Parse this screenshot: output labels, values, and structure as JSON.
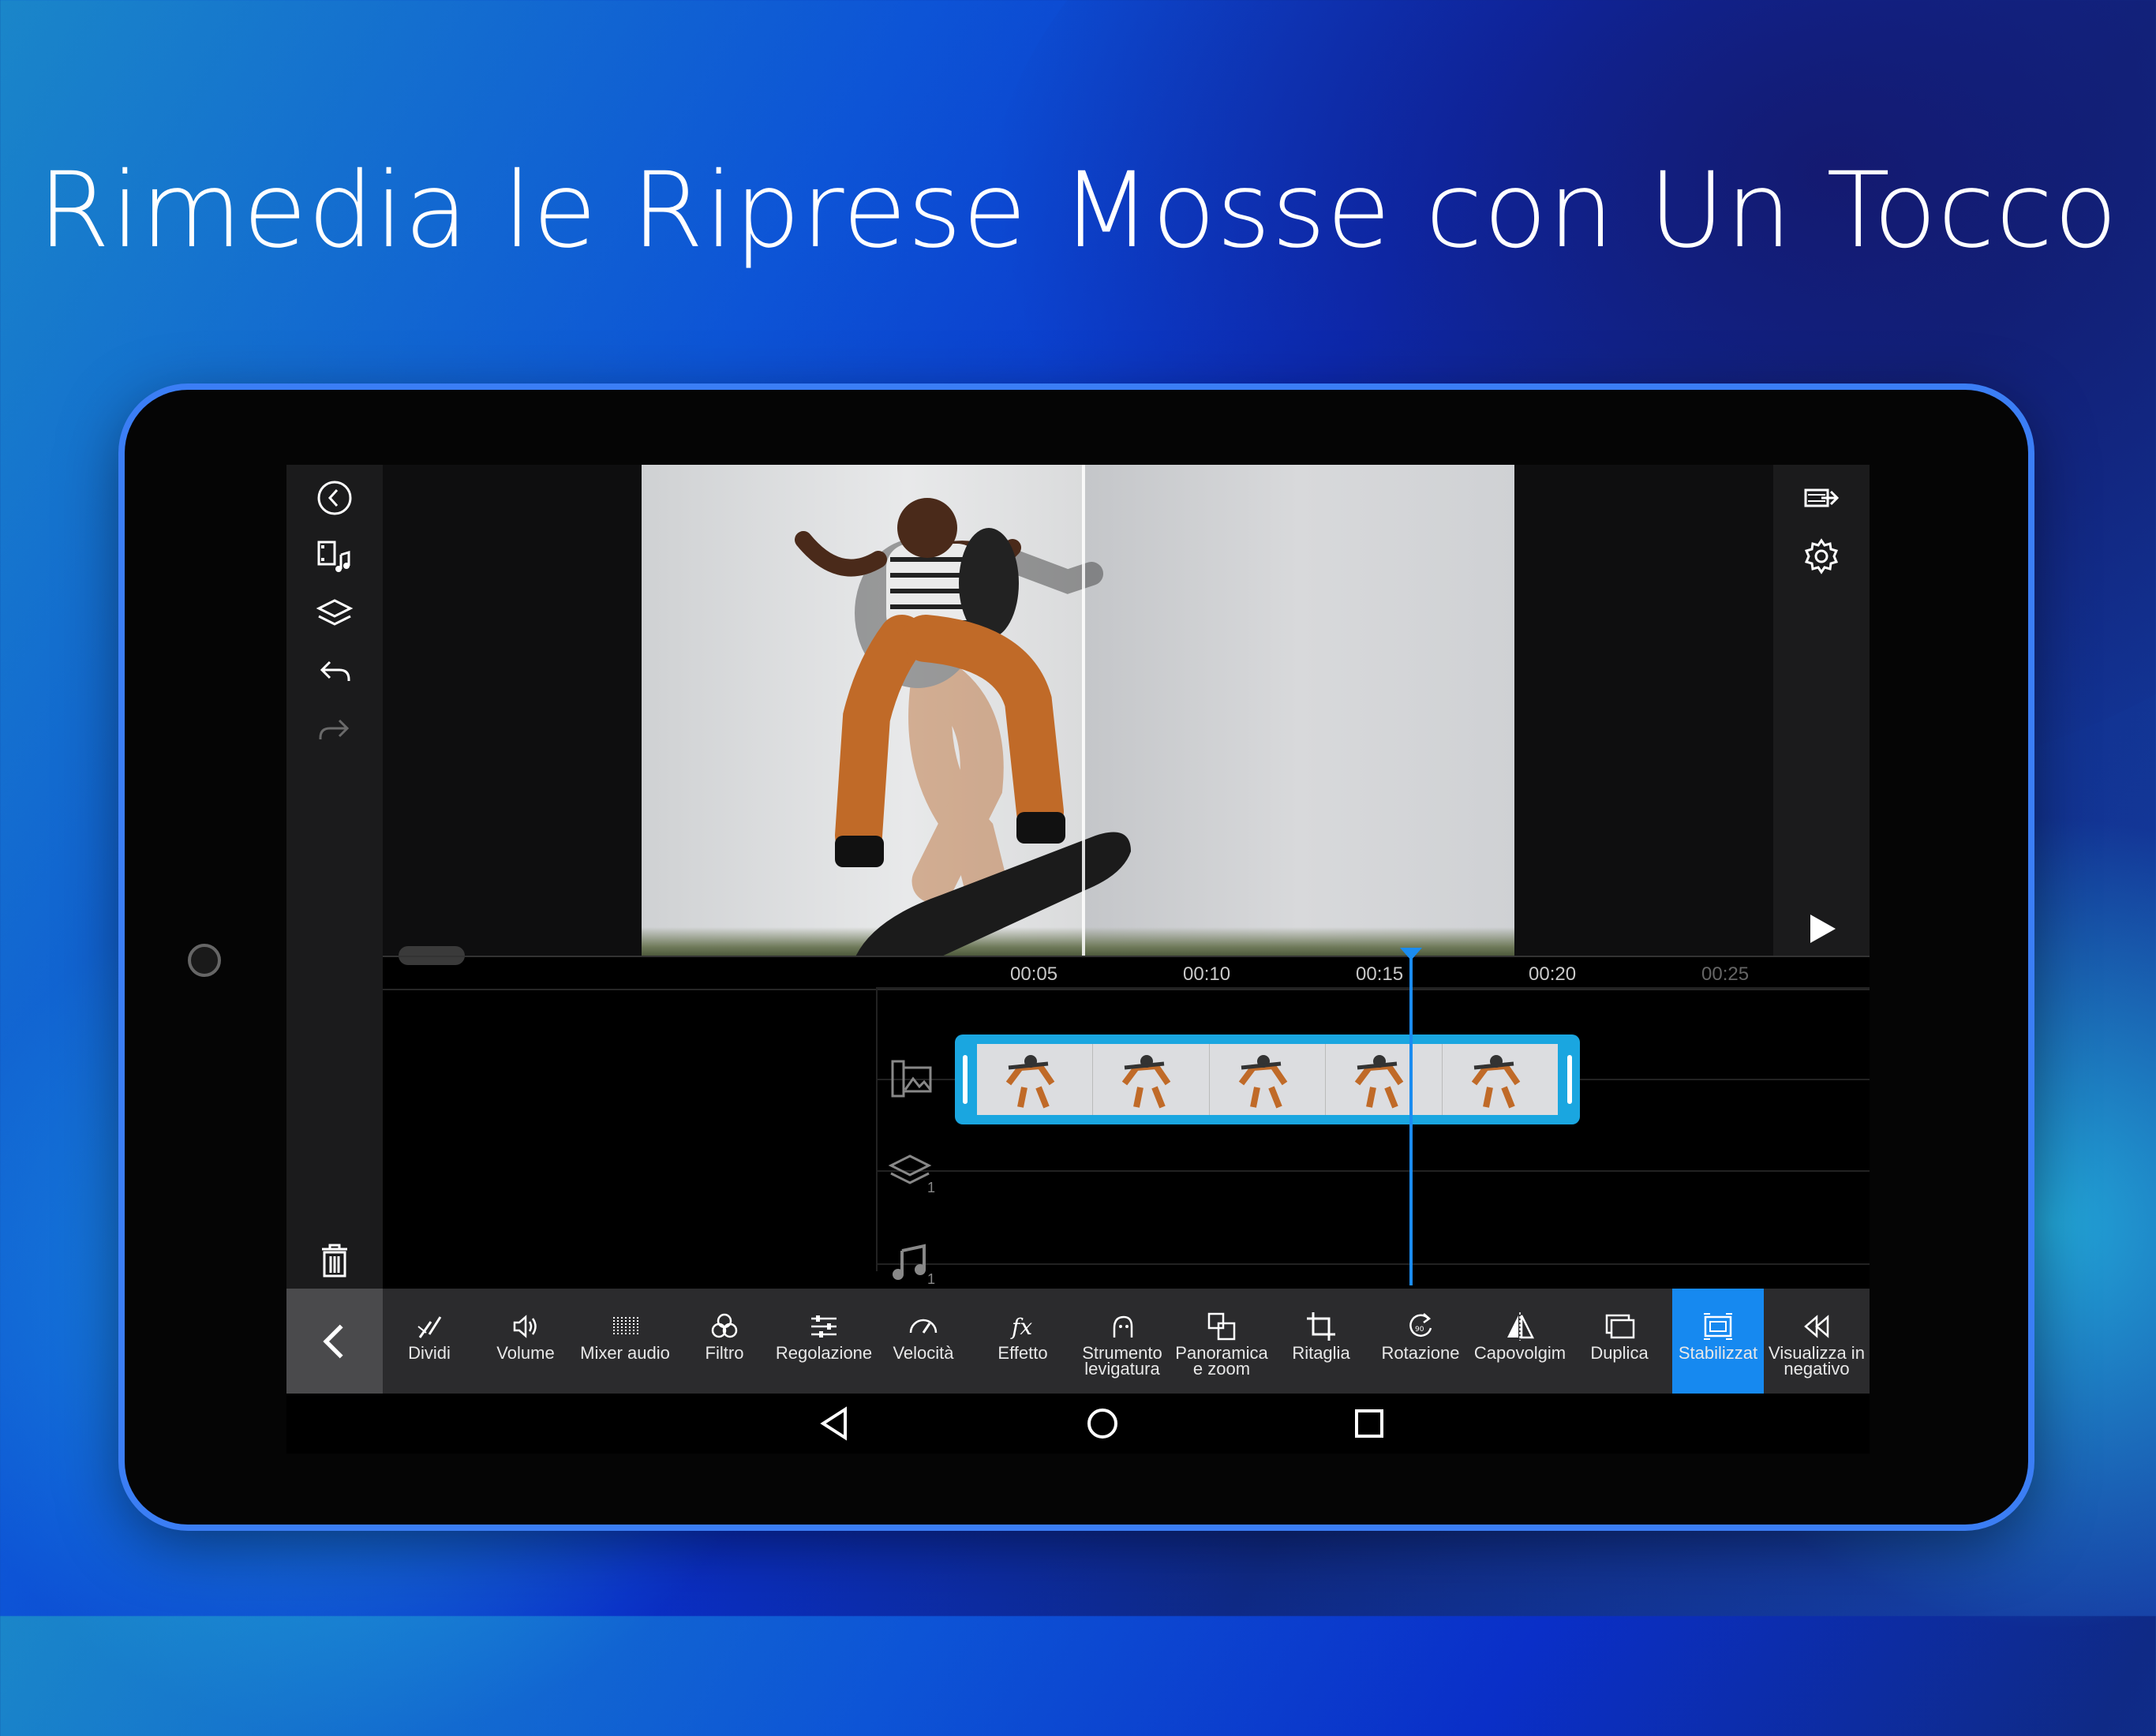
{
  "headline": "Rimedia le Riprese Mosse con Un Tocco",
  "colors": {
    "accent": "#1689f0",
    "clip": "#1aa6e0",
    "toolbar": "#2b2b2d"
  },
  "left_toolbar": [
    {
      "icon": "back-circle-icon"
    },
    {
      "icon": "media-library-icon"
    },
    {
      "icon": "layers-icon"
    },
    {
      "icon": "undo-icon"
    },
    {
      "icon": "redo-icon"
    },
    {
      "icon": "delete-icon"
    }
  ],
  "right_toolbar": [
    {
      "icon": "export-icon"
    },
    {
      "icon": "settings-icon"
    },
    {
      "icon": "play-icon"
    }
  ],
  "timeline": {
    "ticks": [
      "00:05",
      "00:10",
      "00:15",
      "00:20",
      "00:25"
    ],
    "tracks": [
      {
        "icon": "video-track-icon"
      },
      {
        "icon": "layer-track-icon",
        "count": "1"
      },
      {
        "icon": "music-track-icon",
        "count": "1"
      }
    ]
  },
  "tools": [
    {
      "label": "Dividi",
      "icon": "split-icon"
    },
    {
      "label": "Volume",
      "icon": "volume-icon"
    },
    {
      "label": "Mixer audio",
      "icon": "audio-mixer-icon"
    },
    {
      "label": "Filtro",
      "icon": "filter-icon"
    },
    {
      "label": "Regolazione",
      "icon": "adjust-icon"
    },
    {
      "label": "Velocità",
      "icon": "speed-icon"
    },
    {
      "label": "Effetto",
      "icon": "effect-icon"
    },
    {
      "label": "Strumento levigatura",
      "icon": "skin-smooth-icon"
    },
    {
      "label": "Panoramica e zoom",
      "icon": "pan-zoom-icon"
    },
    {
      "label": "Ritaglia",
      "icon": "crop-icon"
    },
    {
      "label": "Rotazione",
      "icon": "rotate-icon"
    },
    {
      "label": "Capovolgim",
      "icon": "flip-icon"
    },
    {
      "label": "Duplica",
      "icon": "duplicate-icon"
    },
    {
      "label": "Stabilizzat",
      "icon": "stabilize-icon",
      "active": true
    },
    {
      "label": "Visualizza in negativo",
      "icon": "reverse-icon"
    }
  ],
  "nav": [
    {
      "icon": "nav-back-icon"
    },
    {
      "icon": "nav-home-icon"
    },
    {
      "icon": "nav-recents-icon"
    }
  ]
}
